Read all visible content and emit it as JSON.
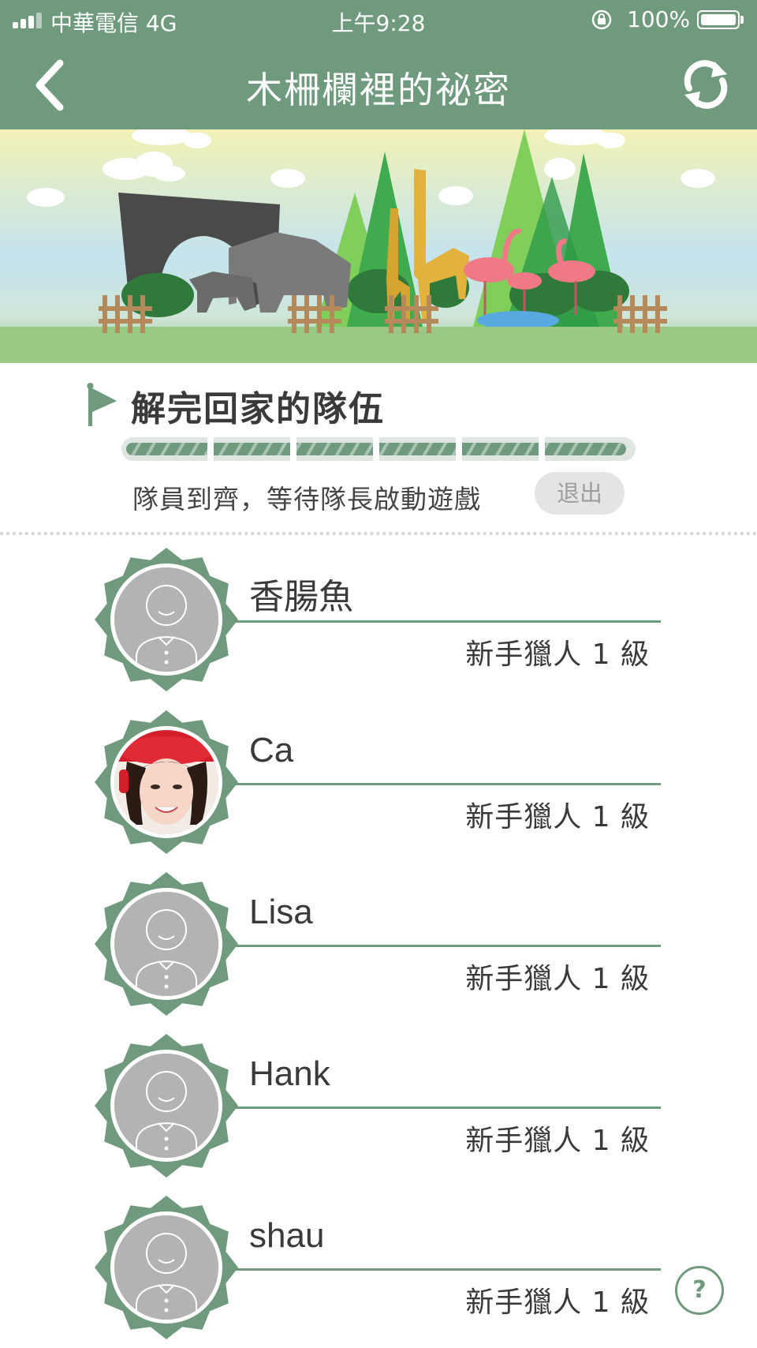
{
  "status_bar": {
    "carrier": "中華電信  4G",
    "time": "上午9:28",
    "battery": "100%"
  },
  "nav": {
    "title": "木柵欄裡的祕密",
    "back_icon": "chevron-left-icon",
    "refresh_icon": "refresh-icon"
  },
  "mission": {
    "title": "解完回家的隊伍",
    "progress": 1.0,
    "status_text": "隊員到齊，等待隊長啟動遊戲",
    "exit_label": "退出"
  },
  "members": [
    {
      "name": "香腸魚",
      "level": "新手獵人 1 級",
      "avatar": "default-avatar"
    },
    {
      "name": "Ca",
      "level": "新手獵人 1 級",
      "avatar": "photo-avatar"
    },
    {
      "name": "Lisa",
      "level": "新手獵人 1 級",
      "avatar": "default-avatar"
    },
    {
      "name": "Hank",
      "level": "新手獵人 1 級",
      "avatar": "default-avatar"
    },
    {
      "name": "shau",
      "level": "新手獵人 1 級",
      "avatar": "default-avatar"
    }
  ],
  "help": {
    "label": "?"
  },
  "colors": {
    "primary": "#6f9a7e",
    "avatar_gray": "#b3b3b3",
    "exit_bg": "#e4e4e4"
  }
}
